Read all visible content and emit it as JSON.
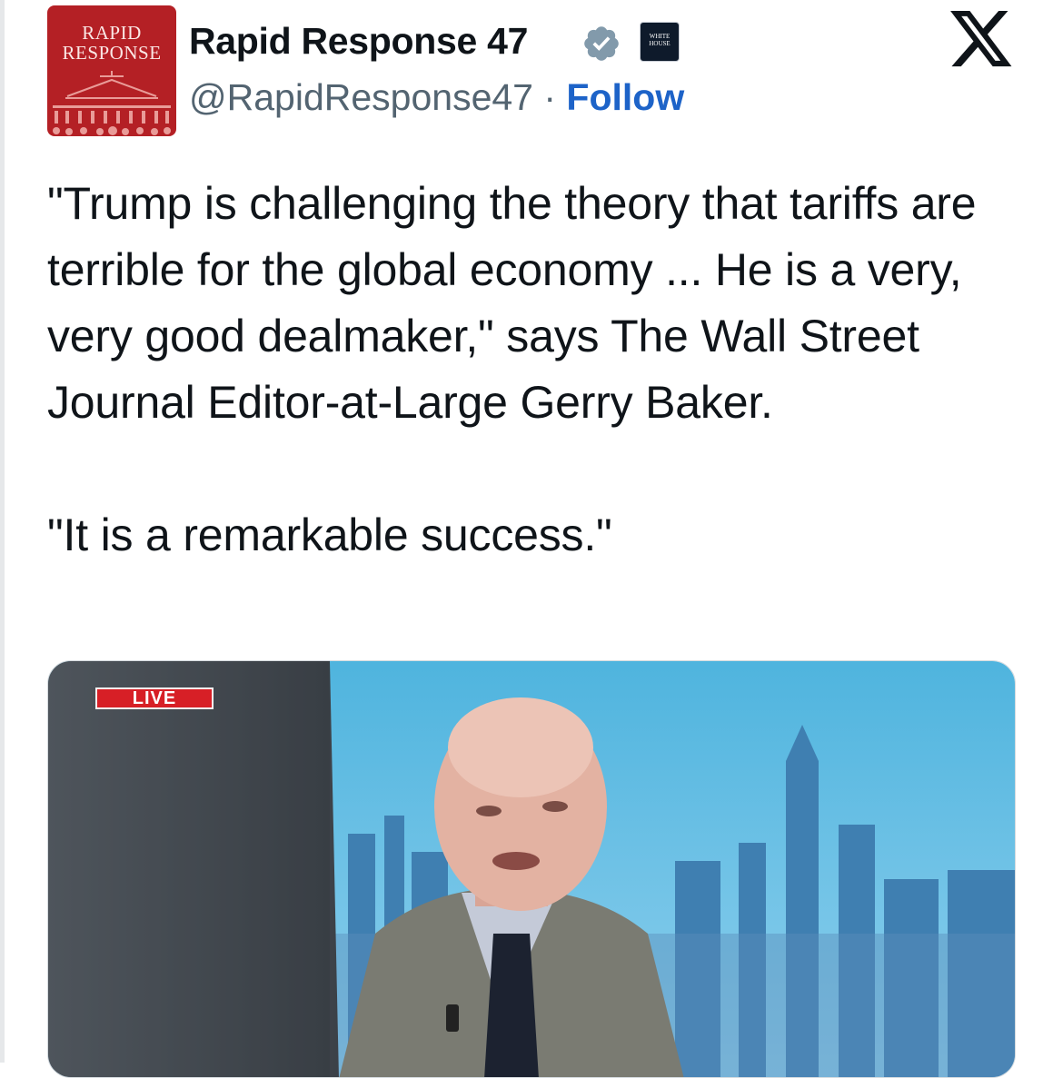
{
  "author": {
    "avatar_text_line1": "RAPID",
    "avatar_text_line2": "RESPONSE",
    "display_name": "Rapid Response 47",
    "verified_icon": "verified-badge-icon",
    "affiliation_badge_line1": "WHITE",
    "affiliation_badge_line2": "HOUSE",
    "handle": "@RapidResponse47",
    "separator": " · ",
    "follow_label": "Follow"
  },
  "platform_icon": "x-logo-icon",
  "tweet": {
    "paragraph1": "\"Trump is challenging the theory that tariffs are terrible for the global economy ... He is a very, very good dealmaker,\" says The Wall Street Journal Editor-at-Large Gerry Baker.",
    "paragraph2": "\"It is a remarkable success.\""
  },
  "media": {
    "live_badge": "LIVE"
  },
  "colors": {
    "avatar_bg": "#b42025",
    "follow_link": "#1d63c8",
    "verified_badge": "#829aab",
    "live_badge": "#d71f26"
  }
}
